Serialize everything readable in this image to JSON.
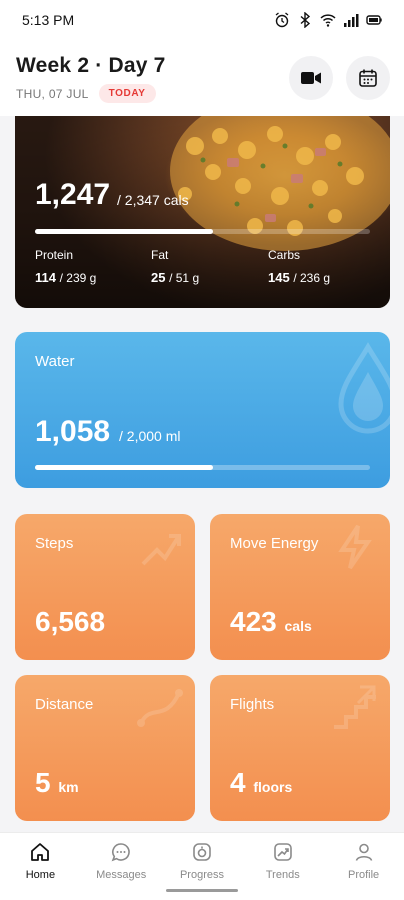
{
  "status_bar": {
    "time": "5:13 PM",
    "icons": [
      "alarm-icon",
      "bluetooth-icon",
      "wifi-icon",
      "signal-icon",
      "battery-icon"
    ]
  },
  "header": {
    "title": "Week 2 · Day 7",
    "date": "THU, 07 JUL",
    "badge": "TODAY",
    "buttons": [
      "video-icon",
      "calendar-icon"
    ]
  },
  "calories": {
    "value": "1,247",
    "goal": "/ 2,347 cals",
    "progress_fraction": 0.53,
    "macros": [
      {
        "label": "Protein",
        "value": "114",
        "goal": "/ 239 g"
      },
      {
        "label": "Fat",
        "value": "25",
        "goal": "/ 51 g"
      },
      {
        "label": "Carbs",
        "value": "145",
        "goal": "/ 236 g"
      }
    ]
  },
  "water": {
    "label": "Water",
    "value": "1,058",
    "goal": "/ 2,000 ml",
    "progress_fraction": 0.53
  },
  "tiles": [
    {
      "label": "Steps",
      "value": "6,568",
      "unit": ""
    },
    {
      "label": "Move Energy",
      "value": "423",
      "unit": "cals"
    },
    {
      "label": "Distance",
      "value": "5",
      "unit": "km"
    },
    {
      "label": "Flights",
      "value": "4",
      "unit": "floors"
    }
  ],
  "nav": [
    {
      "label": "Home",
      "icon": "home-icon",
      "active": true
    },
    {
      "label": "Messages",
      "icon": "messages-icon",
      "active": false
    },
    {
      "label": "Progress",
      "icon": "progress-icon",
      "active": false
    },
    {
      "label": "Trends",
      "icon": "trends-icon",
      "active": false
    },
    {
      "label": "Profile",
      "icon": "profile-icon",
      "active": false
    }
  ],
  "colors": {
    "accent_red": "#e53935",
    "water_blue": "#4aa9e6",
    "tile_orange": "#f49a5c"
  }
}
